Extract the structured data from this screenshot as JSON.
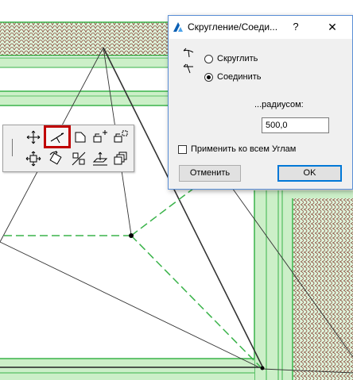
{
  "dialog": {
    "title": "Скругление/Соеди...",
    "help_label": "?",
    "close_label": "✕",
    "option_round": "Скруглить",
    "option_join": "Соединить",
    "selected_option": "option_join",
    "radius_label": "...радиусом:",
    "radius_value": "500,0",
    "apply_all_label": "Применить ко всем Углам",
    "apply_all_checked": false,
    "cancel_label": "Отменить",
    "ok_label": "OK"
  },
  "palette": {
    "highlighted_tool": "fillet-chamfer-tool",
    "highlight_color": "#c00000"
  },
  "colors": {
    "fill_green": "#ccefc8",
    "line_green": "#3ab34a",
    "tile_brown": "#8b4a3c",
    "accent_blue": "#0078d7"
  }
}
